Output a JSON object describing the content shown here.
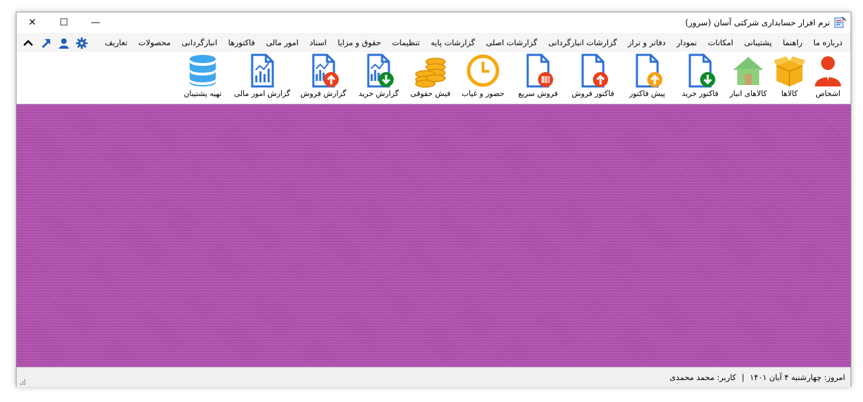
{
  "window": {
    "title": "نرم افزار حسابداری شرکتی آسان (سرور)",
    "controls": {
      "minimize": "—",
      "maximize": "☐",
      "close": "✕"
    }
  },
  "menu": {
    "items": [
      "تعاریف",
      "محصولات",
      "انبارگردانی",
      "فاکتورها",
      "امور مالی",
      "اسناد",
      "حقوق و مزایا",
      "تنظیمات",
      "گزارشات پایه",
      "گزارشات اصلی",
      "گزارشات انبارگردانی",
      "دفاتر و تراز",
      "نمودار",
      "امکانات",
      "پشتیبانی",
      "راهنما",
      "درباره ما"
    ],
    "icons": [
      "settings-gear-icon",
      "user-icon",
      "arrow-up-right-icon",
      "chevron-up-icon"
    ],
    "icon_color": "#1f5db8"
  },
  "toolbar": {
    "items": [
      {
        "label": "اشخاص",
        "icon": "person-icon"
      },
      {
        "label": "کالاها",
        "icon": "box-icon"
      },
      {
        "label": "کالاهای انبار",
        "icon": "warehouse-icon"
      },
      {
        "label": "فاکتور خرید",
        "icon": "invoice-buy-icon"
      },
      {
        "label": "پیش فاکتور",
        "icon": "proforma-icon"
      },
      {
        "label": "فاکتور فروش",
        "icon": "invoice-sell-icon"
      },
      {
        "label": "فروش سریع",
        "icon": "barcode-document-icon"
      },
      {
        "label": "حضور و غیاب",
        "icon": "clock-icon"
      },
      {
        "label": "فیش حقوقی",
        "icon": "coins-icon"
      },
      {
        "label": "گزارش خرید",
        "icon": "report-buy-icon"
      },
      {
        "label": "گزارش فروش",
        "icon": "report-sell-icon"
      },
      {
        "label": "گزارش امور مالی",
        "icon": "report-finance-icon"
      },
      {
        "label": "تهیه پشتیبان",
        "icon": "database-icon"
      }
    ]
  },
  "colors": {
    "workspace": "#b552b3",
    "doc_blue": "#2a6fd6",
    "green_badge": "#0d8a2a",
    "red_badge": "#e8401c",
    "orange_badge": "#f5a11a",
    "gold": "#f6b11a",
    "db_blue": "#3fa7ee"
  },
  "status": {
    "today": "امروز: چهارشنبه ۴ آبان ۱۴۰۱",
    "separator": "|",
    "user": "کاربر: محمد محمدی"
  }
}
